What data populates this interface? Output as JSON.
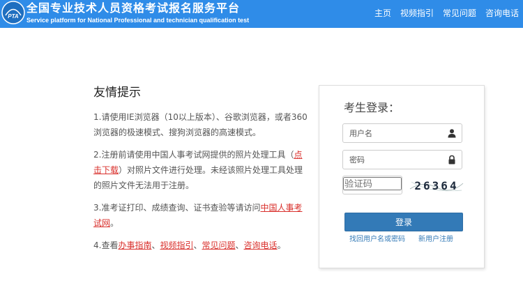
{
  "header": {
    "title_cn": "全国专业技术人员资格考试报名服务平台",
    "title_en": "Service platform for National Professional and technician qualification test",
    "logo_text": "PTA",
    "bg_color": "#2f8ce8",
    "nav": [
      {
        "label": "主页"
      },
      {
        "label": "视频指引"
      },
      {
        "label": "常见问题"
      },
      {
        "label": "咨询电话"
      }
    ]
  },
  "tips": {
    "title": "友情提示",
    "tip1": "1.请使用IE浏览器（10以上版本）、谷歌浏览器，或者360浏览器的极速模式、搜狗浏览器的高速模式。",
    "tip2_before": "2.注册前请使用中国人事考试网提供的照片处理工具（",
    "tip2_link": "点击下载",
    "tip2_after": "）对照片文件进行处理。未经该照片处理工具处理的照片文件无法用于注册。",
    "tip3_before": "3.准考证打印、成绩查询、证书查验等请访问",
    "tip3_link": "中国人事考试网",
    "tip3_after": "。",
    "tip4_before": "4.查看",
    "tip4_link1": "办事指南",
    "sep": "、",
    "tip4_link2": "视频指引",
    "tip4_link3": "常见问题",
    "tip4_link4": "咨询电话",
    "tip4_after": "。",
    "link_color": "#d9302c"
  },
  "login": {
    "title": "考生登录：",
    "username_placeholder": "用户名",
    "password_placeholder": "密码",
    "captcha_placeholder": "验证码",
    "captcha_text": "26364",
    "button_label": "登录",
    "button_color": "#337ab7",
    "find_link": "找回用户名或密码",
    "register_link": "新用户注册",
    "user_icon": "user-icon",
    "lock_icon": "lock-icon"
  }
}
